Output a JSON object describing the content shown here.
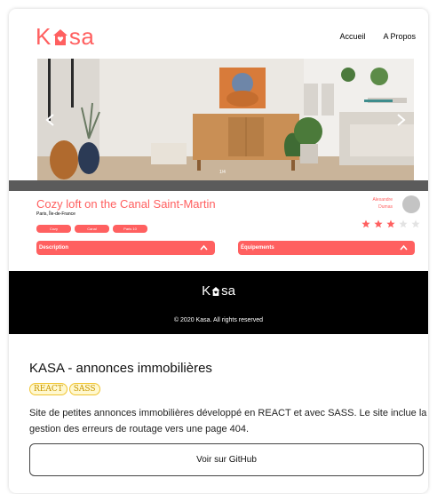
{
  "header": {
    "logo_left": "K",
    "logo_right": "sa",
    "nav": [
      "Accueil",
      "A Propos"
    ]
  },
  "carousel": {
    "counter": "1/4",
    "arrow_left_icon": "chevron-left-icon",
    "arrow_right_icon": "chevron-right-icon"
  },
  "listing": {
    "title": "Cozy loft on the Canal Saint-Martin",
    "location": "Paris, Île-de-France",
    "tags": [
      "Cozy",
      "Canal",
      "Paris 10"
    ],
    "host_first": "Alexandre",
    "host_last": "Dumas",
    "rating": 3,
    "rating_max": 5,
    "description_label": "Description",
    "equipments_label": "Équipements"
  },
  "footer": {
    "logo_left": "K",
    "logo_right": "sa",
    "copyright": "© 2020 Kasa. All rights reserved"
  },
  "project": {
    "title": "KASA - annonces immobilières",
    "badges": [
      "REACT",
      "SASS"
    ],
    "description": "Site de petites annonces immobilières développé en REACT et avec SASS. Le site inclue la gestion des erreurs de routage vers une page 404.",
    "button_label": "Voir sur GitHub"
  },
  "colors": {
    "accent": "#ff6060",
    "star_empty": "#e3e3e3",
    "footer_bg": "#000000",
    "badge_border": "#f0c430"
  }
}
